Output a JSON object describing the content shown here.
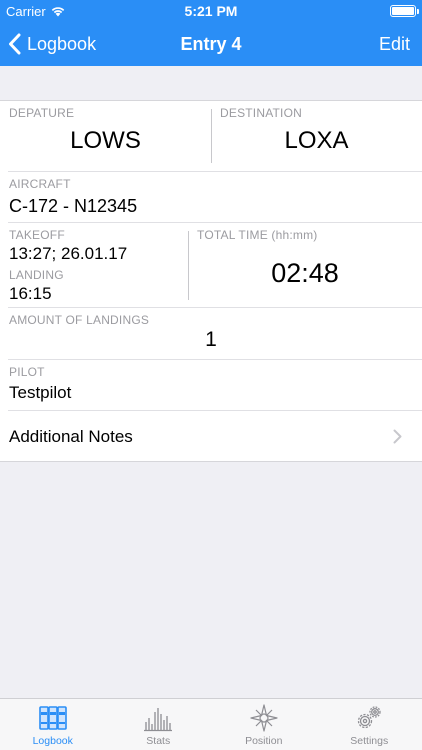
{
  "status_bar": {
    "carrier": "Carrier",
    "time": "5:21 PM"
  },
  "nav": {
    "back_label": "Logbook",
    "title": "Entry 4",
    "edit_label": "Edit"
  },
  "entry": {
    "departure": {
      "label": "DEPATURE",
      "value": "LOWS"
    },
    "destination": {
      "label": "DESTINATION",
      "value": "LOXA"
    },
    "aircraft": {
      "label": "AIRCRAFT",
      "value": "C-172 - N12345"
    },
    "takeoff": {
      "label": "TAKEOFF",
      "value": "13:27; 26.01.17"
    },
    "landing": {
      "label": "LANDING",
      "value": "16:15"
    },
    "total_time": {
      "label": "TOTAL TIME (hh:mm)",
      "value": "02:48"
    },
    "landings": {
      "label": "AMOUNT OF LANDINGS",
      "value": "1"
    },
    "pilot": {
      "label": "PILOT",
      "value": "Testpilot"
    },
    "notes": {
      "label": "Additional Notes"
    }
  },
  "tabs": [
    {
      "label": "Logbook",
      "icon": "logbook-icon",
      "active": true
    },
    {
      "label": "Stats",
      "icon": "stats-icon"
    },
    {
      "label": "Position",
      "icon": "compass-icon"
    },
    {
      "label": "Settings",
      "icon": "gears-icon"
    }
  ],
  "colors": {
    "accent": "#2a8ef6",
    "background": "#efeff4",
    "label": "#9b9ba0",
    "tab_inactive": "#8e8e93"
  }
}
